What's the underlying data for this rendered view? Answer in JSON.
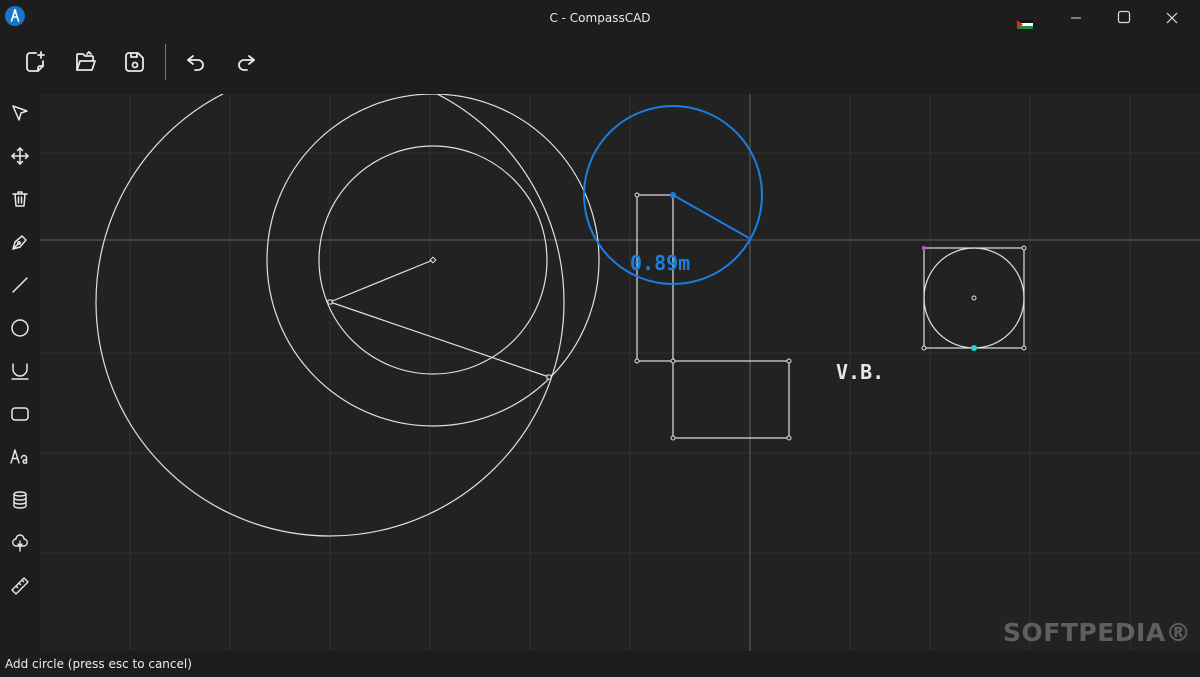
{
  "window": {
    "title": "C - CompassCAD",
    "minimize_icon": "minimize-icon",
    "maximize_icon": "maximize-icon",
    "close_icon": "close-icon"
  },
  "toolbar": {
    "buttons": [
      {
        "name": "new-file",
        "icon": "new-file-icon"
      },
      {
        "name": "open-file",
        "icon": "folder-open-icon"
      },
      {
        "name": "save-file",
        "icon": "save-icon"
      },
      {
        "name": "undo",
        "icon": "undo-icon"
      },
      {
        "name": "redo",
        "icon": "redo-icon"
      }
    ]
  },
  "sidebar": {
    "tools": [
      {
        "name": "select",
        "icon": "pointer-icon"
      },
      {
        "name": "move",
        "icon": "move-icon"
      },
      {
        "name": "delete",
        "icon": "trash-icon"
      },
      {
        "name": "pen",
        "icon": "pen-icon"
      },
      {
        "name": "line",
        "icon": "line-icon"
      },
      {
        "name": "circle",
        "icon": "circle-icon"
      },
      {
        "name": "arc",
        "icon": "arc-icon"
      },
      {
        "name": "rectangle",
        "icon": "rounded-rect-icon"
      },
      {
        "name": "text",
        "icon": "text-icon"
      },
      {
        "name": "database",
        "icon": "database-icon"
      },
      {
        "name": "tree",
        "icon": "tree-icon"
      },
      {
        "name": "ruler",
        "icon": "ruler-icon"
      }
    ]
  },
  "canvas": {
    "measurement_label": "0.89m",
    "text_label": "V.B.",
    "accent_color": "#1a7fe0"
  },
  "status": {
    "message": "Add circle (press esc to cancel)"
  },
  "watermark": "SOFTPEDIA®"
}
